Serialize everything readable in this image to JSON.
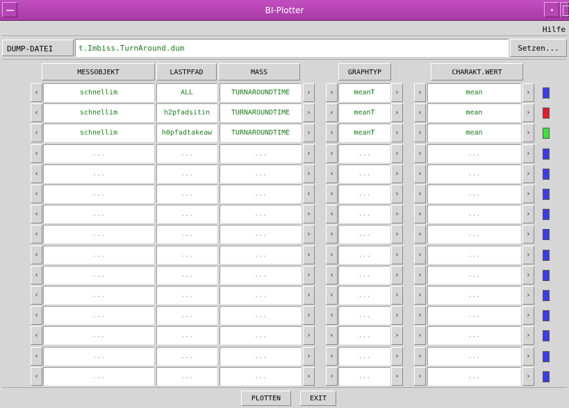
{
  "window": {
    "title": "BI-Plotter"
  },
  "menubar": {
    "help_label": "Hilfe"
  },
  "dump": {
    "label": "DUMP-DATEI",
    "value": "t.Imbiss.TurnAround.dum",
    "set_button": "Setzen..."
  },
  "headers": {
    "messobjekt": "MESSOBJEKT",
    "lastpfad": "LASTPFAD",
    "mass": "MASS",
    "graphtyp": "GRAPHTYP",
    "charakt_wert": "CHARAKT.WERT"
  },
  "arrows": {
    "left": "‹",
    "right": "›"
  },
  "rows": [
    {
      "messobjekt": "schnellim",
      "lastpfad": "ALL",
      "mass": "TURNAROUNDTIME",
      "graphtyp": "meanT",
      "wert": "mean",
      "color": "#3c3ce6"
    },
    {
      "messobjekt": "schnellim",
      "lastpfad": "h2pfadsitin",
      "mass": "TURNAROUNDTIME",
      "graphtyp": "meanT",
      "wert": "mean",
      "color": "#e01e2b"
    },
    {
      "messobjekt": "schnellim",
      "lastpfad": "h0pfadtakeaw",
      "mass": "TURNAROUNDTIME",
      "graphtyp": "meanT",
      "wert": "mean",
      "color": "#3ee03e"
    },
    {
      "messobjekt": "...",
      "lastpfad": "...",
      "mass": "...",
      "graphtyp": "...",
      "wert": "...",
      "color": "#3c3ce6"
    },
    {
      "messobjekt": "...",
      "lastpfad": "...",
      "mass": "...",
      "graphtyp": "...",
      "wert": "...",
      "color": "#3c3ce6"
    },
    {
      "messobjekt": "...",
      "lastpfad": "...",
      "mass": "...",
      "graphtyp": "...",
      "wert": "...",
      "color": "#3c3ce6"
    },
    {
      "messobjekt": "...",
      "lastpfad": "...",
      "mass": "...",
      "graphtyp": "...",
      "wert": "...",
      "color": "#3c3ce6"
    },
    {
      "messobjekt": "...",
      "lastpfad": "...",
      "mass": "...",
      "graphtyp": "...",
      "wert": "...",
      "color": "#3c3ce6"
    },
    {
      "messobjekt": "...",
      "lastpfad": "...",
      "mass": "...",
      "graphtyp": "...",
      "wert": "...",
      "color": "#3c3ce6"
    },
    {
      "messobjekt": "...",
      "lastpfad": "...",
      "mass": "...",
      "graphtyp": "...",
      "wert": "...",
      "color": "#3c3ce6"
    },
    {
      "messobjekt": "...",
      "lastpfad": "...",
      "mass": "...",
      "graphtyp": "...",
      "wert": "...",
      "color": "#3c3ce6"
    },
    {
      "messobjekt": "...",
      "lastpfad": "...",
      "mass": "...",
      "graphtyp": "...",
      "wert": "...",
      "color": "#3c3ce6"
    },
    {
      "messobjekt": "...",
      "lastpfad": "...",
      "mass": "...",
      "graphtyp": "...",
      "wert": "...",
      "color": "#3c3ce6"
    },
    {
      "messobjekt": "...",
      "lastpfad": "...",
      "mass": "...",
      "graphtyp": "...",
      "wert": "...",
      "color": "#3c3ce6"
    },
    {
      "messobjekt": "...",
      "lastpfad": "...",
      "mass": "...",
      "graphtyp": "...",
      "wert": "...",
      "color": "#3c3ce6"
    }
  ],
  "buttons": {
    "plot": "PLOTTEN",
    "exit": "EXIT"
  }
}
